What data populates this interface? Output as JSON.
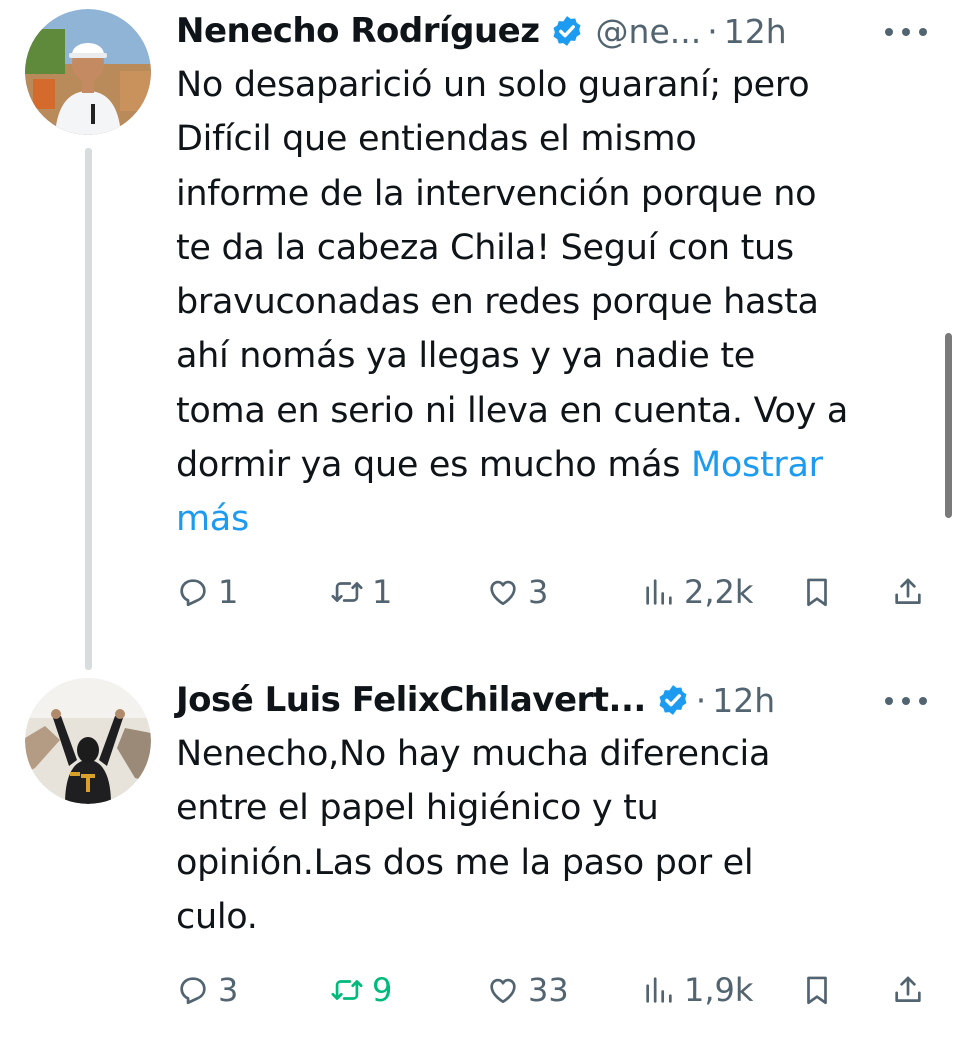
{
  "colors": {
    "text": "#0f1419",
    "secondary": "#536471",
    "link": "#1d9bf0",
    "verified": "#1d9bf0",
    "retweet_active": "#00ba7c",
    "thread_line": "#d7dcdf"
  },
  "tweets": [
    {
      "author": {
        "display_name": "Nenecho Rodríguez",
        "handle": "@ne...",
        "verified": true,
        "avatar": "avatar-hardhat"
      },
      "time": "12h",
      "text_lines": [
        "No desaparició un solo guaraní; pero",
        "Difícil que entiendas el mismo",
        "informe de la intervención porque no",
        "te da la cabeza Chila! Seguí con tus",
        "bravuconadas en redes porque hasta",
        "ahí nomás ya llegas y ya nadie te",
        "toma en serio ni lleva en cuenta. Voy a",
        "dormir ya que es mucho más"
      ],
      "show_more": [
        "Mostrar",
        "más"
      ],
      "actions": {
        "replies": "1",
        "retweets": "1",
        "likes": "3",
        "views": "2,2k"
      },
      "retweeted": false
    },
    {
      "author": {
        "display_name": "José Luis FelixChilavert...",
        "verified": true,
        "avatar": "avatar-celebration"
      },
      "time": "12h",
      "text_lines": [
        "Nenecho,No hay mucha diferencia",
        "entre el papel higiénico y tu",
        "opinión.Las dos me la paso por el",
        "culo."
      ],
      "actions": {
        "replies": "3",
        "retweets": "9",
        "likes": "33",
        "views": "1,9k"
      },
      "retweeted": true
    }
  ],
  "icons": [
    "reply-icon",
    "retweet-icon",
    "like-icon",
    "views-icon",
    "bookmark-icon",
    "share-icon",
    "more-icon",
    "verified-badge-icon"
  ]
}
